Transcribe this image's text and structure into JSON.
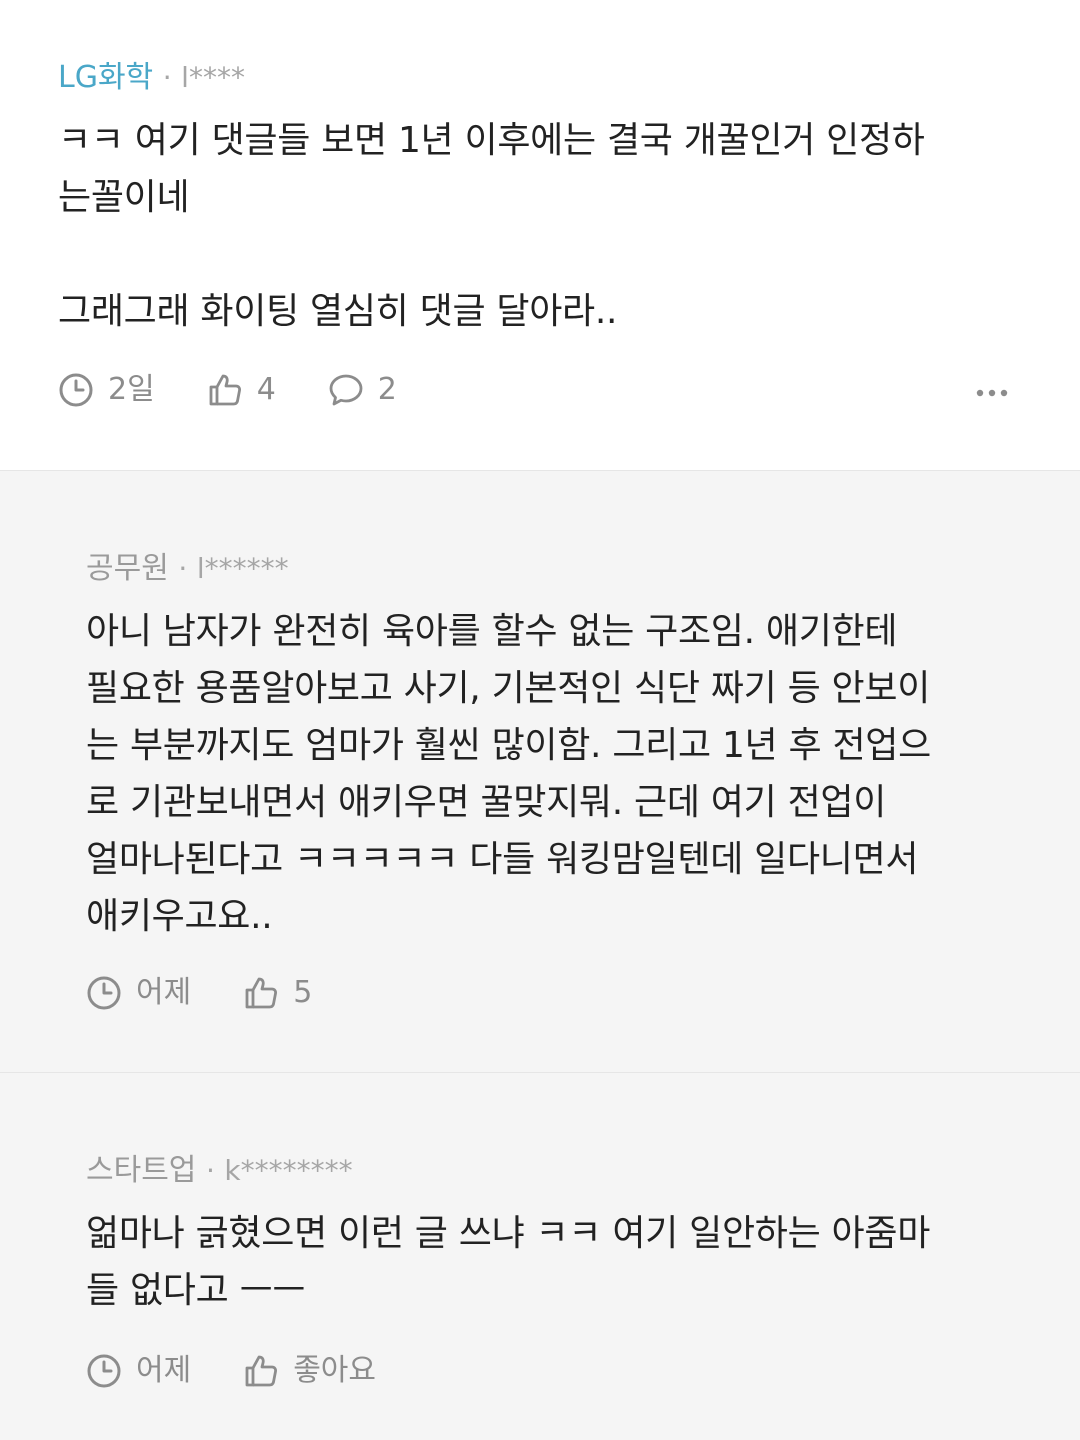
{
  "comments": [
    {
      "company": "LG화학",
      "separator": "·",
      "user": "l****",
      "text": "ㅋㅋ 여기 댓글들 보면 1년 이후에는 결국 개꿀인거 인정하\n는꼴이네\n\n그래그래 화이팅 열심히 댓글 달아라..",
      "time": "2일",
      "likes": "4",
      "replies": "2",
      "accent_color": "#4aa7c8"
    },
    {
      "company": "공무원",
      "separator": "·",
      "user": "l******",
      "text": "아니 남자가 완전히 육아를 할수 없는 구조임. 애기한테\n필요한 용품알아보고 사기, 기본적인 식단 짜기 등 안보이\n는 부분까지도 엄마가 훨씬 많이함. 그리고 1년 후 전업으\n로 기관보내면서 애키우면 꿀맞지뭐. 근데 여기 전업이\n얼마나된다고 ㅋㅋㅋㅋㅋ 다들 워킹맘일텐데 일다니면서\n애키우고요..",
      "time": "어제",
      "likes": "5"
    },
    {
      "company": "스타트업",
      "separator": "·",
      "user": "k********",
      "text": "얾마나 긁혔으면 이런 글 쓰냐 ㅋㅋ 여기 일안하는 아줌마\n들 없다고 ㅡㅡ",
      "time": "어제",
      "likes": "좋아요"
    }
  ],
  "icons": {
    "clock": "clock-icon",
    "like": "thumbs-up-icon",
    "reply": "speech-bubble-icon",
    "more": "more-dots-icon"
  }
}
